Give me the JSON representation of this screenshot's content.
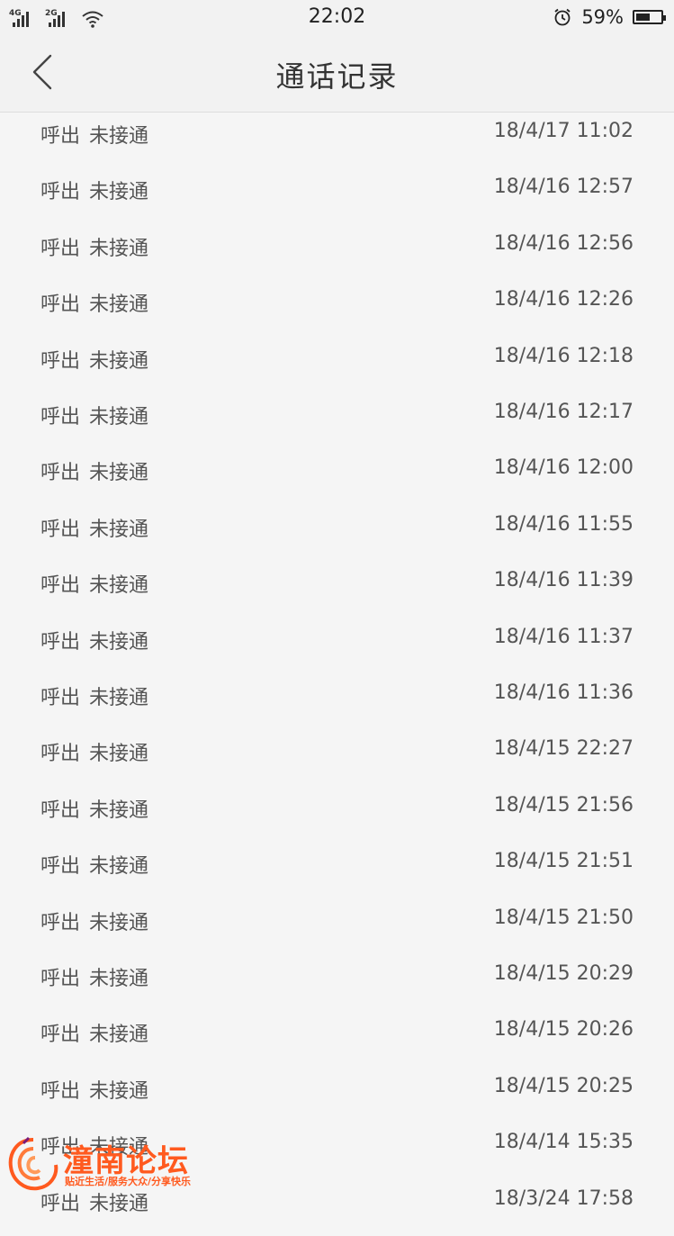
{
  "status_bar": {
    "sim1_network": "4G",
    "sim2_network": "2G",
    "time": "22:02",
    "battery_percent": "59%",
    "battery_level": 0.59
  },
  "header": {
    "title": "通话记录",
    "back_icon": "chevron-left-icon"
  },
  "calls": [
    {
      "direction": "呼出",
      "status": "未接通",
      "time": "18/4/17 11:02"
    },
    {
      "direction": "呼出",
      "status": "未接通",
      "time": "18/4/16 12:57"
    },
    {
      "direction": "呼出",
      "status": "未接通",
      "time": "18/4/16 12:56"
    },
    {
      "direction": "呼出",
      "status": "未接通",
      "time": "18/4/16 12:26"
    },
    {
      "direction": "呼出",
      "status": "未接通",
      "time": "18/4/16 12:18"
    },
    {
      "direction": "呼出",
      "status": "未接通",
      "time": "18/4/16 12:17"
    },
    {
      "direction": "呼出",
      "status": "未接通",
      "time": "18/4/16 12:00"
    },
    {
      "direction": "呼出",
      "status": "未接通",
      "time": "18/4/16 11:55"
    },
    {
      "direction": "呼出",
      "status": "未接通",
      "time": "18/4/16 11:39"
    },
    {
      "direction": "呼出",
      "status": "未接通",
      "time": "18/4/16 11:37"
    },
    {
      "direction": "呼出",
      "status": "未接通",
      "time": "18/4/16 11:36"
    },
    {
      "direction": "呼出",
      "status": "未接通",
      "time": "18/4/15 22:27"
    },
    {
      "direction": "呼出",
      "status": "未接通",
      "time": "18/4/15 21:56"
    },
    {
      "direction": "呼出",
      "status": "未接通",
      "time": "18/4/15 21:51"
    },
    {
      "direction": "呼出",
      "status": "未接通",
      "time": "18/4/15 21:50"
    },
    {
      "direction": "呼出",
      "status": "未接通",
      "time": "18/4/15 20:29"
    },
    {
      "direction": "呼出",
      "status": "未接通",
      "time": "18/4/15 20:26"
    },
    {
      "direction": "呼出",
      "status": "未接通",
      "time": "18/4/15 20:25"
    },
    {
      "direction": "呼出",
      "status": "未接通",
      "time": "18/4/14 15:35"
    },
    {
      "direction": "呼出",
      "status": "未接通",
      "time": "18/3/24 17:58"
    }
  ],
  "watermark": {
    "name": "潼南论坛",
    "slogan": "贴近生活/服务大众/分享快乐",
    "color": "#ff5a1f"
  }
}
